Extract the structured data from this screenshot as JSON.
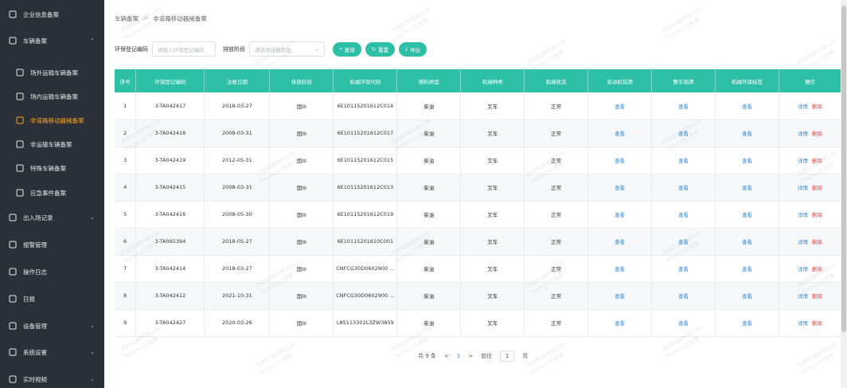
{
  "sidebar": {
    "items": [
      {
        "label": "企业信息备案",
        "icon": "building-icon",
        "sub": false,
        "active": false,
        "chev": false
      },
      {
        "label": "车辆备案",
        "icon": "shield-icon",
        "sub": false,
        "active": false,
        "chev": true,
        "chev_char": "⌃"
      },
      {
        "label": "场外运输车辆备案",
        "icon": "truck-icon",
        "sub": true,
        "active": false,
        "chev": false
      },
      {
        "label": "场内运输车辆备案",
        "icon": "home-truck-icon",
        "sub": true,
        "active": false,
        "chev": false
      },
      {
        "label": "非道路移动器械备案",
        "icon": "excavator-icon",
        "sub": true,
        "active": true,
        "chev": false
      },
      {
        "label": "非运输车辆备案",
        "icon": "car-icon",
        "sub": true,
        "active": false,
        "chev": false
      },
      {
        "label": "特殊车辆备案",
        "icon": "special-vehicle-icon",
        "sub": true,
        "active": false,
        "chev": false
      },
      {
        "label": "应急事件备案",
        "icon": "emergency-icon",
        "sub": true,
        "active": false,
        "chev": false
      },
      {
        "label": "出入场记录",
        "icon": "record-icon",
        "sub": false,
        "active": false,
        "chev": true,
        "chev_char": "⌄"
      },
      {
        "label": "报警管理",
        "icon": "warning-icon",
        "sub": false,
        "active": false,
        "chev": false
      },
      {
        "label": "操作日志",
        "icon": "log-icon",
        "sub": false,
        "active": false,
        "chev": false
      },
      {
        "label": "日报",
        "icon": "report-icon",
        "sub": false,
        "active": false,
        "chev": false
      },
      {
        "label": "设备管理",
        "icon": "device-icon",
        "sub": false,
        "active": false,
        "chev": true,
        "chev_char": "⌄"
      },
      {
        "label": "系统设置",
        "icon": "settings-icon",
        "sub": false,
        "active": false,
        "chev": true,
        "chev_char": "⌄"
      },
      {
        "label": "实时视频",
        "icon": "video-icon",
        "sub": false,
        "active": false,
        "chev": true,
        "chev_char": "⌄"
      }
    ]
  },
  "breadcrumb": {
    "root": "车辆备案",
    "sep": ">",
    "current": "非道路移动器械备案"
  },
  "filter": {
    "code_label": "环保登记编码",
    "code_placeholder": "请输入环保登记编码",
    "stage_label": "排放阶段",
    "stage_placeholder": "请选择排放阶段",
    "query": "查询",
    "reset": "重置",
    "export": "导出"
  },
  "table": {
    "headers": [
      "序号",
      "环保登记编码",
      "注册日期",
      "排放阶段",
      "机械环保代码",
      "燃料类型",
      "机械种类",
      "机械状态",
      "发动机铭牌",
      "整车铭牌",
      "机械环保标签",
      "操作"
    ],
    "view": "查看",
    "detail": "详情",
    "delete": "删除",
    "rows": [
      [
        "1",
        "3-TA042417",
        "2018-03-27",
        "国III",
        "6E10115201612C014",
        "柴油",
        "叉车",
        "正常"
      ],
      [
        "2",
        "3-TA042418",
        "2008-03-31",
        "国III",
        "6E10115201612C017",
        "柴油",
        "叉车",
        "正常"
      ],
      [
        "3",
        "3-TA042419",
        "2012-05-31",
        "国III",
        "6E10115201612C015",
        "柴油",
        "叉车",
        "正常"
      ],
      [
        "4",
        "3-TA042415",
        "2008-03-31",
        "国III",
        "6E10115201612C013",
        "柴油",
        "叉车",
        "正常"
      ],
      [
        "5",
        "3-TA042416",
        "2008-05-30",
        "国III",
        "6E10115201612C019",
        "柴油",
        "叉车",
        "正常"
      ],
      [
        "6",
        "3-TA065394",
        "2018-05-27",
        "国III",
        "6E10115201610C001",
        "柴油",
        "叉车",
        "正常"
      ],
      [
        "7",
        "3-TA042414",
        "2018-03-27",
        "国III",
        "CNFCG30D0602900 ...",
        "柴油",
        "叉车",
        "正常"
      ],
      [
        "8",
        "3-TA042412",
        "2021-10-31",
        "国III",
        "CNFCG30D0602900 ...",
        "柴油",
        "叉车",
        "正常"
      ],
      [
        "9",
        "3-TA042427",
        "2020-03-26",
        "国III",
        "L85113302L3ZW3859",
        "柴油",
        "叉车",
        "正常"
      ]
    ]
  },
  "pager": {
    "total": "共 9 条",
    "prev": "<",
    "page": "1",
    "next": ">",
    "goto": "前往",
    "goto_value": "1",
    "page_suffix": "页"
  },
  "watermark": {
    "line1": "西部机械有限公司",
    "line2": "Padmin已登录"
  }
}
